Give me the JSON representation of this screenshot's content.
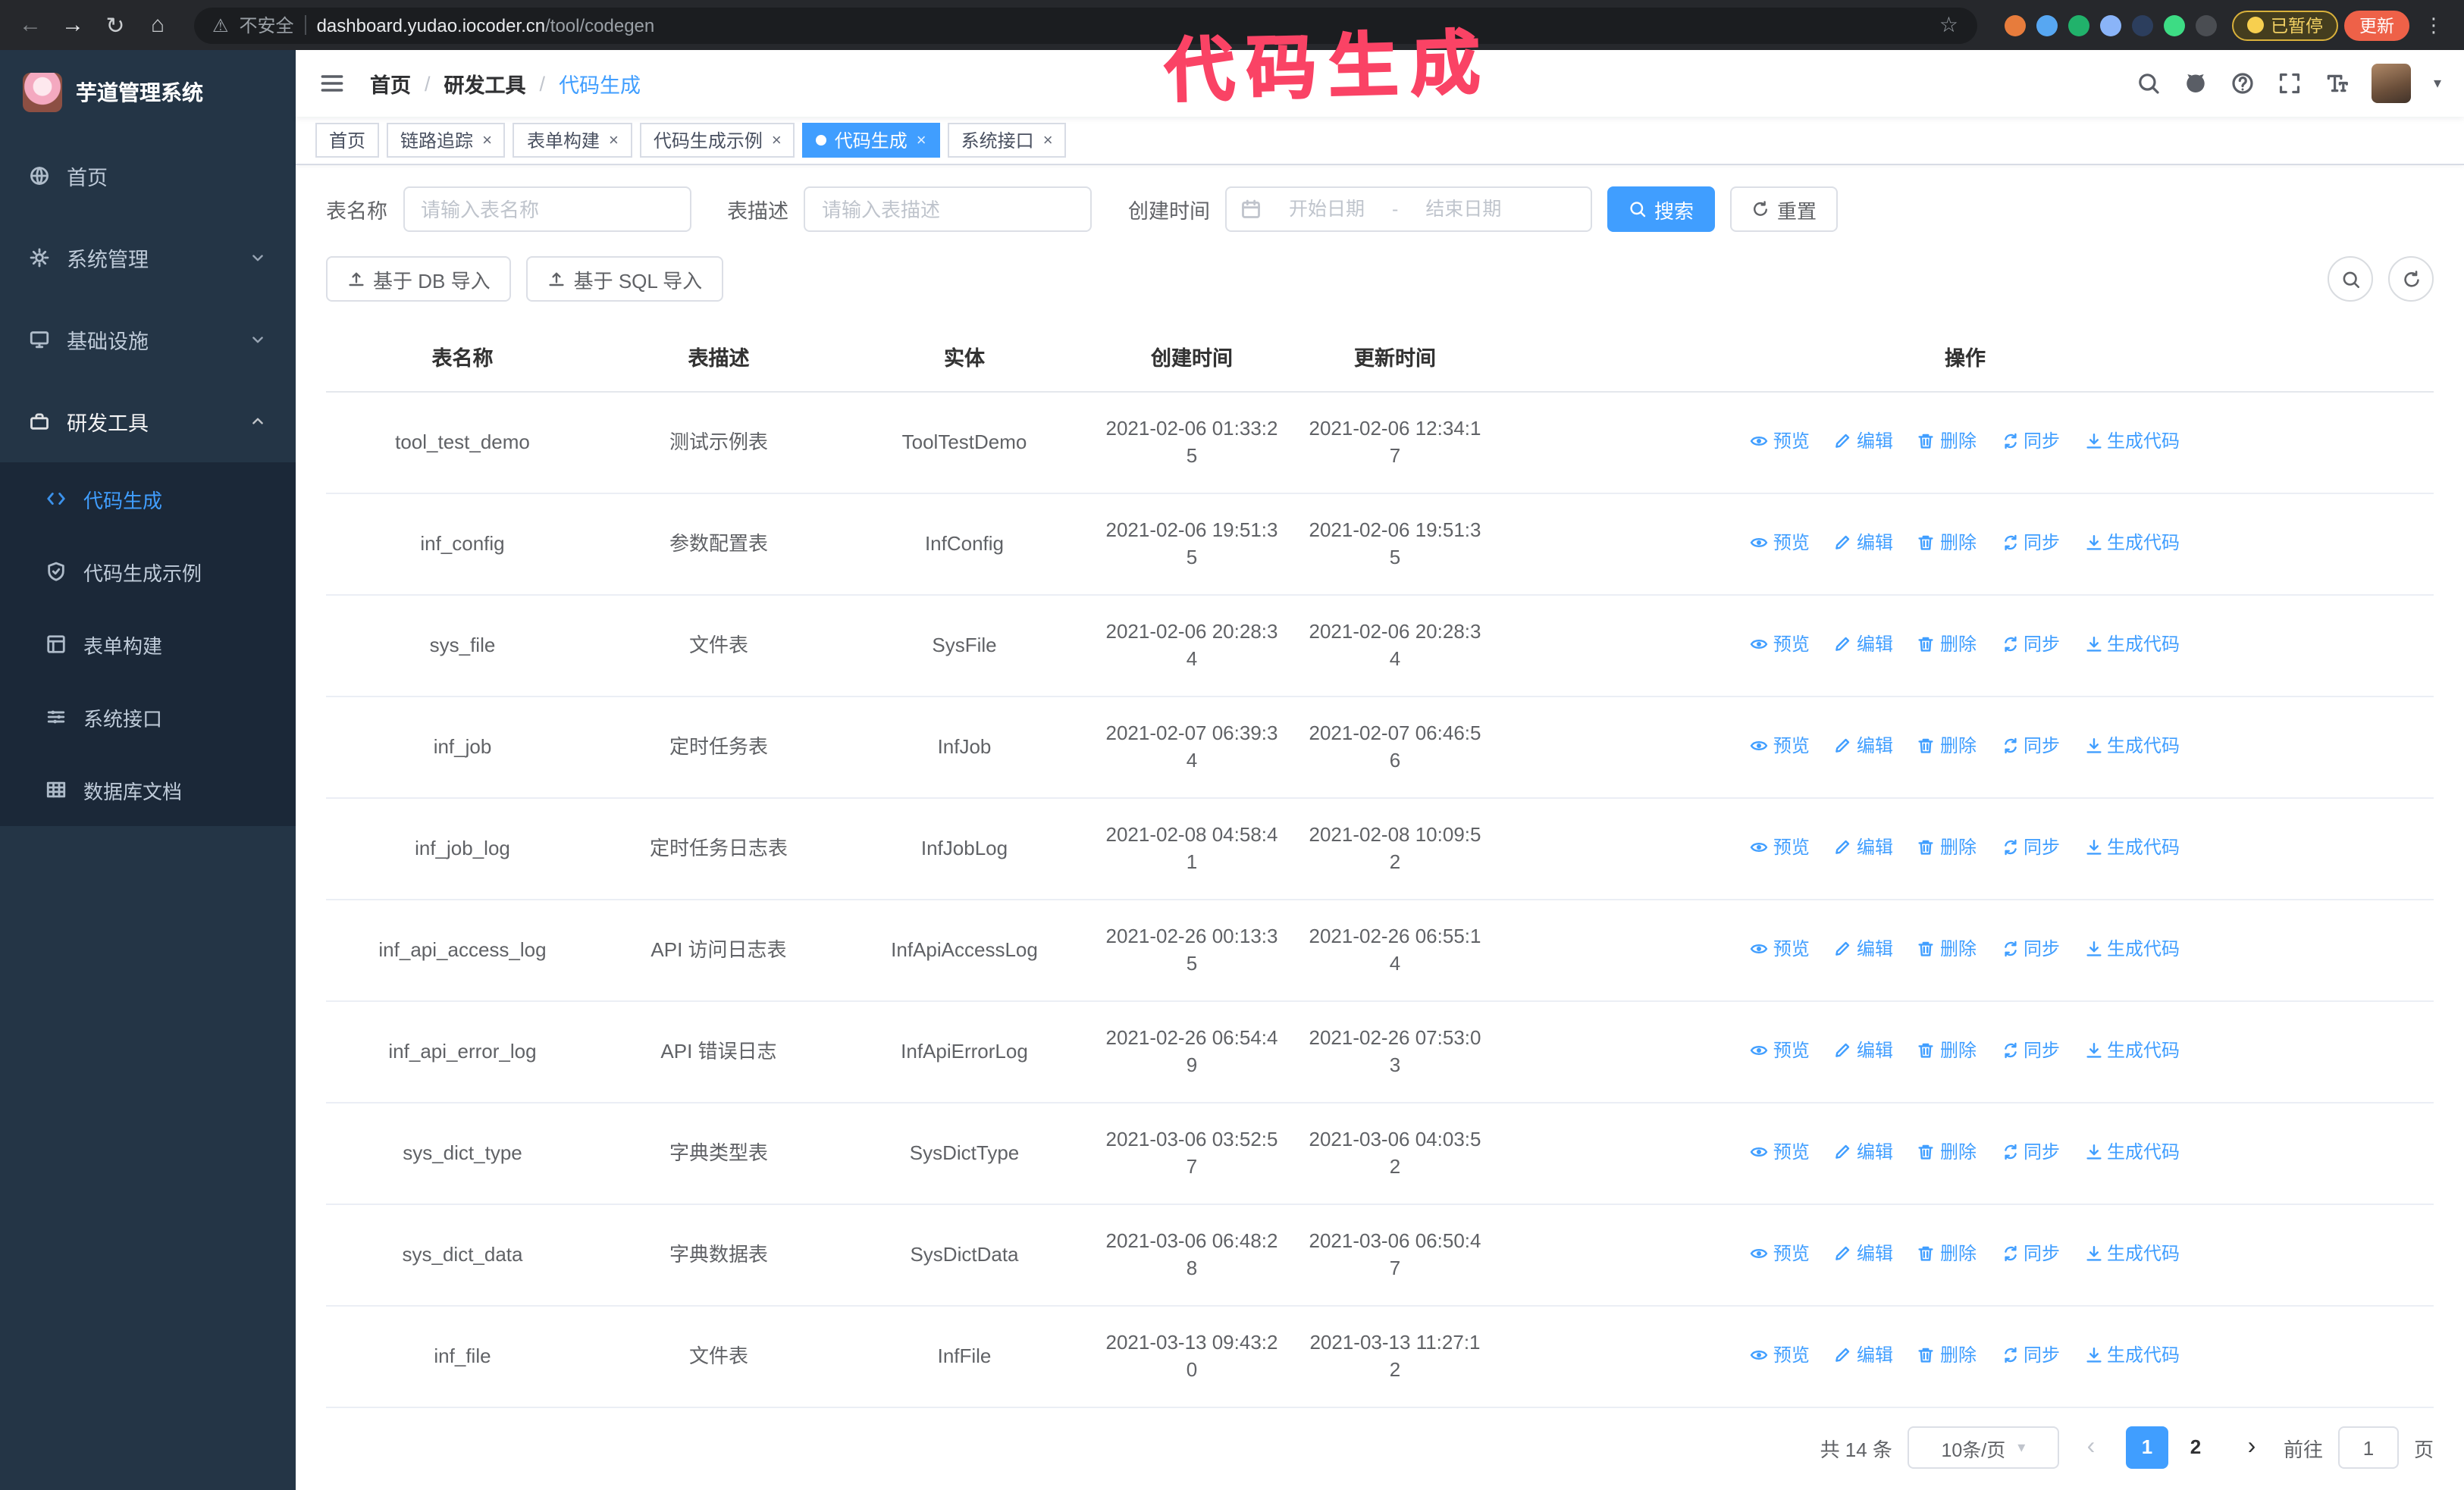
{
  "annotation": {
    "text": "代码生成",
    "color": "#fa4365"
  },
  "browser": {
    "security_label": "不安全",
    "url_host": "dashboard.yudao.iocoder.cn",
    "url_path": "/tool/codegen",
    "paused_badge": "已暂停",
    "update_button": "更新",
    "extension_icons": [
      {
        "name": "extension-icon-1",
        "color": "#e77c3c"
      },
      {
        "name": "extension-icon-2",
        "color": "#57a7f2"
      },
      {
        "name": "extension-icon-3",
        "color": "#21b26b"
      },
      {
        "name": "extension-icon-4",
        "color": "#8ab4f8"
      },
      {
        "name": "extension-icon-5",
        "color": "#2c3e5d"
      },
      {
        "name": "extension-icon-6",
        "color": "#3ddc84"
      },
      {
        "name": "extension-icon-7",
        "color": "#4a4d52"
      }
    ]
  },
  "sidebar": {
    "app_title": "芋道管理系统",
    "items": [
      {
        "label": "首页",
        "icon": "globe"
      },
      {
        "label": "系统管理",
        "icon": "gear",
        "expandable": true
      },
      {
        "label": "基础设施",
        "icon": "monitor",
        "expandable": true
      },
      {
        "label": "研发工具",
        "icon": "toolbox",
        "expanded": true
      }
    ],
    "submenu": [
      {
        "label": "代码生成",
        "icon": "code",
        "active": true
      },
      {
        "label": "代码生成示例",
        "icon": "shield"
      },
      {
        "label": "表单构建",
        "icon": "form"
      },
      {
        "label": "系统接口",
        "icon": "sliders"
      },
      {
        "label": "数据库文档",
        "icon": "table-grid"
      }
    ]
  },
  "header": {
    "breadcrumb": [
      "首页",
      "研发工具",
      "代码生成"
    ]
  },
  "tabs": [
    {
      "label": "首页",
      "closable": false,
      "active": false
    },
    {
      "label": "链路追踪",
      "closable": true,
      "active": false
    },
    {
      "label": "表单构建",
      "closable": true,
      "active": false
    },
    {
      "label": "代码生成示例",
      "closable": true,
      "active": false
    },
    {
      "label": "代码生成",
      "closable": true,
      "active": true
    },
    {
      "label": "系统接口",
      "closable": true,
      "active": false
    }
  ],
  "filters": {
    "table_name_label": "表名称",
    "table_name_placeholder": "请输入表名称",
    "table_desc_label": "表描述",
    "table_desc_placeholder": "请输入表描述",
    "create_time_label": "创建时间",
    "date_start_placeholder": "开始日期",
    "date_separator": "-",
    "date_end_placeholder": "结束日期",
    "search_button": "搜索",
    "reset_button": "重置"
  },
  "toolbar": {
    "import_db": "基于 DB 导入",
    "import_sql": "基于 SQL 导入"
  },
  "table": {
    "columns": [
      "表名称",
      "表描述",
      "实体",
      "创建时间",
      "更新时间",
      "操作"
    ],
    "actions": [
      {
        "label": "预览",
        "icon": "eye"
      },
      {
        "label": "编辑",
        "icon": "edit"
      },
      {
        "label": "删除",
        "icon": "trash"
      },
      {
        "label": "同步",
        "icon": "sync"
      },
      {
        "label": "生成代码",
        "icon": "download"
      }
    ],
    "rows": [
      {
        "name": "tool_test_demo",
        "desc": "测试示例表",
        "entity": "ToolTestDemo",
        "created": "2021-02-06 01:33:25",
        "updated": "2021-02-06 12:34:17"
      },
      {
        "name": "inf_config",
        "desc": "参数配置表",
        "entity": "InfConfig",
        "created": "2021-02-06 19:51:35",
        "updated": "2021-02-06 19:51:35"
      },
      {
        "name": "sys_file",
        "desc": "文件表",
        "entity": "SysFile",
        "created": "2021-02-06 20:28:34",
        "updated": "2021-02-06 20:28:34"
      },
      {
        "name": "inf_job",
        "desc": "定时任务表",
        "entity": "InfJob",
        "created": "2021-02-07 06:39:34",
        "updated": "2021-02-07 06:46:56"
      },
      {
        "name": "inf_job_log",
        "desc": "定时任务日志表",
        "entity": "InfJobLog",
        "created": "2021-02-08 04:58:41",
        "updated": "2021-02-08 10:09:52"
      },
      {
        "name": "inf_api_access_log",
        "desc": "API 访问日志表",
        "entity": "InfApiAccessLog",
        "created": "2021-02-26 00:13:35",
        "updated": "2021-02-26 06:55:14"
      },
      {
        "name": "inf_api_error_log",
        "desc": "API 错误日志",
        "entity": "InfApiErrorLog",
        "created": "2021-02-26 06:54:49",
        "updated": "2021-02-26 07:53:03"
      },
      {
        "name": "sys_dict_type",
        "desc": "字典类型表",
        "entity": "SysDictType",
        "created": "2021-03-06 03:52:57",
        "updated": "2021-03-06 04:03:52"
      },
      {
        "name": "sys_dict_data",
        "desc": "字典数据表",
        "entity": "SysDictData",
        "created": "2021-03-06 06:48:28",
        "updated": "2021-03-06 06:50:47"
      },
      {
        "name": "inf_file",
        "desc": "文件表",
        "entity": "InfFile",
        "created": "2021-03-13 09:43:20",
        "updated": "2021-03-13 11:27:12"
      }
    ]
  },
  "pagination": {
    "total": "共 14 条",
    "page_size": "10条/页",
    "prev": "‹",
    "next": "›",
    "pages": [
      "1",
      "2"
    ],
    "active_page": "1",
    "goto_label": "前往",
    "goto_value": "1",
    "goto_suffix": "页"
  }
}
